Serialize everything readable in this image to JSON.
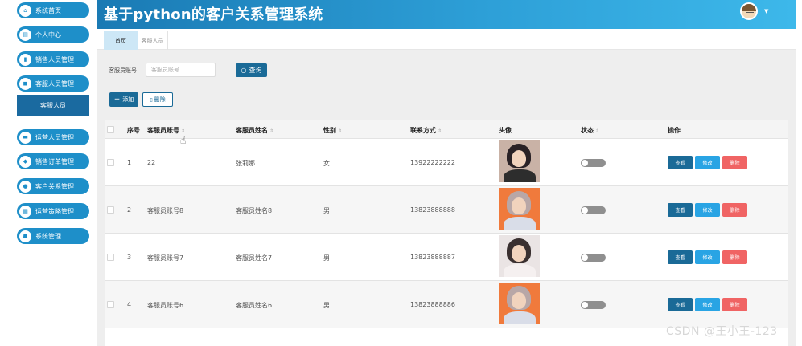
{
  "app": {
    "title": "基于python的客户关系管理系统"
  },
  "sidebar": {
    "items": [
      {
        "label": "系统首页",
        "icon": "home-icon",
        "glyph": "⌂"
      },
      {
        "label": "个人中心",
        "icon": "id-card-icon",
        "glyph": "▤"
      },
      {
        "label": "销售人员管理",
        "icon": "book-icon",
        "glyph": "▮"
      },
      {
        "label": "客服人员管理",
        "icon": "chat-icon",
        "glyph": "◼"
      },
      {
        "label": "运营人员管理",
        "icon": "document-icon",
        "glyph": "▬"
      },
      {
        "label": "销售订单管理",
        "icon": "order-icon",
        "glyph": "◆"
      },
      {
        "label": "客户关系管理",
        "icon": "user-icon",
        "glyph": "●"
      },
      {
        "label": "运营策略管理",
        "icon": "strategy-icon",
        "glyph": "▦"
      },
      {
        "label": "系统管理",
        "icon": "settings-icon",
        "glyph": "☗"
      }
    ],
    "submenu": {
      "label": "客服人员"
    }
  },
  "tabs": [
    {
      "label": "首页",
      "active": true
    },
    {
      "label": "客服人员",
      "active": false
    }
  ],
  "search": {
    "label": "客服员账号",
    "placeholder": "客服员账号",
    "button_icon": "search-icon",
    "button_label": "查询"
  },
  "actions": {
    "add_label": "添加",
    "add_glyph": "+",
    "delete_label": "删除",
    "delete_glyph": "🗑"
  },
  "table": {
    "sort_glyph": "⇕",
    "columns": [
      {
        "label": "序号",
        "sortable": false
      },
      {
        "label": "客服员账号",
        "sortable": true
      },
      {
        "label": "客服员姓名",
        "sortable": true
      },
      {
        "label": "性别",
        "sortable": true
      },
      {
        "label": "联系方式",
        "sortable": true
      },
      {
        "label": "头像",
        "sortable": false
      },
      {
        "label": "状态",
        "sortable": true
      },
      {
        "label": "操作",
        "sortable": false
      }
    ],
    "rows": [
      {
        "index": "1",
        "account": "22",
        "name": "张莉娜",
        "gender": "女",
        "phone": "13922222222",
        "avatar_colors": {
          "hair": "#2a2226",
          "bg": "#c9b2a6",
          "shirt": "#2d2d2d"
        },
        "status_on": false
      },
      {
        "index": "2",
        "account": "客服员账号8",
        "name": "客服员姓名8",
        "gender": "男",
        "phone": "13823888888",
        "avatar_colors": {
          "hair": "#b8a7a7",
          "bg": "#f07a3c",
          "shirt": "#d9dde8"
        },
        "status_on": false
      },
      {
        "index": "3",
        "account": "客服员账号7",
        "name": "客服员姓名7",
        "gender": "男",
        "phone": "13823888887",
        "avatar_colors": {
          "hair": "#3a3030",
          "bg": "#eae4e4",
          "shirt": "#f5f0f0"
        },
        "status_on": false
      },
      {
        "index": "4",
        "account": "客服员账号6",
        "name": "客服员姓名6",
        "gender": "男",
        "phone": "13823888886",
        "avatar_colors": {
          "hair": "#b8a7a7",
          "bg": "#f07a3c",
          "shirt": "#d9dde8"
        },
        "status_on": false
      }
    ],
    "row_actions": {
      "view": "查看",
      "edit": "修改",
      "delete": "删除"
    }
  },
  "watermark": "CSDN @王小王-123"
}
